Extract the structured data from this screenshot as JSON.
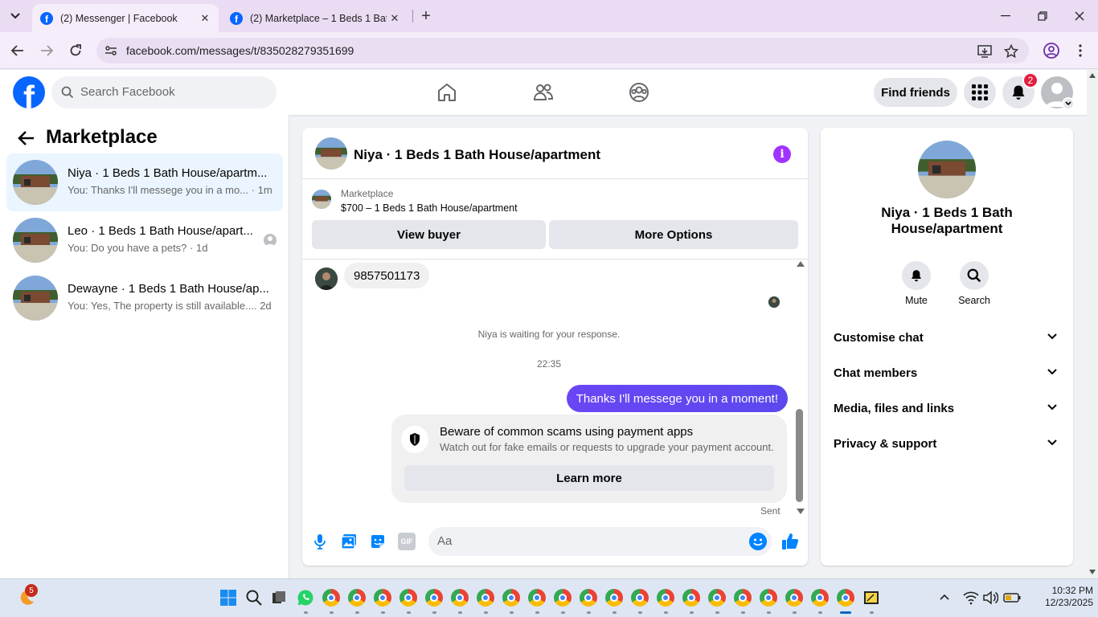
{
  "browser": {
    "tabs": [
      {
        "title": "(2) Messenger | Facebook",
        "active": true
      },
      {
        "title": "(2) Marketplace – 1 Beds 1 Bath",
        "active": false
      }
    ],
    "url": "facebook.com/messages/t/835028279351699"
  },
  "header": {
    "search_placeholder": "Search Facebook",
    "find_friends_label": "Find friends",
    "notification_count": "2"
  },
  "sidebar": {
    "title": "Marketplace",
    "conversations": [
      {
        "name": "Niya · 1 Beds 1 Bath House/apartm...",
        "preview": "You: Thanks I'll messege you in a mo... · 1m",
        "selected": true
      },
      {
        "name": "Leo · 1 Beds 1 Bath House/apart...",
        "preview": "You: Do you have a pets? · 1d",
        "selected": false
      },
      {
        "name": "Dewayne · 1 Beds 1 Bath House/ap...",
        "preview": "You: Yes, The property is still available.... 2d",
        "selected": false
      }
    ]
  },
  "chat": {
    "title": "Niya · 1 Beds 1 Bath House/apartment",
    "listing": {
      "label": "Marketplace",
      "price_title": "$700 – 1 Beds 1 Bath House/apartment",
      "view_buyer_label": "View buyer",
      "more_options_label": "More Options"
    },
    "messages": {
      "incoming_text": "9857501173",
      "waiting_text": "Niya is waiting for your response.",
      "timestamp": "22:35",
      "outgoing_text": "Thanks I'll messege you in a moment!",
      "status": "Sent"
    },
    "scam_notice": {
      "title": "Beware of common scams using payment apps",
      "body": "Watch out for fake emails or requests to upgrade your payment account.",
      "button_label": "Learn more"
    },
    "composer": {
      "placeholder": "Aa",
      "gif_label": "GIF"
    }
  },
  "details": {
    "name": "Niya · 1 Beds 1 Bath House/apartment",
    "actions": [
      {
        "label": "Mute",
        "icon": "bell-icon"
      },
      {
        "label": "Search",
        "icon": "search-icon"
      }
    ],
    "sections": [
      "Customise chat",
      "Chat members",
      "Media, files and links",
      "Privacy & support"
    ]
  },
  "taskbar": {
    "notification_badge": "5",
    "time": "10:32 PM",
    "date": "12/23/2025"
  },
  "colors": {
    "brand": "#0866ff",
    "outgoing_bubble": "#5b48ee",
    "info_accent": "#a033ff",
    "selected_row": "#ebf5ff"
  }
}
